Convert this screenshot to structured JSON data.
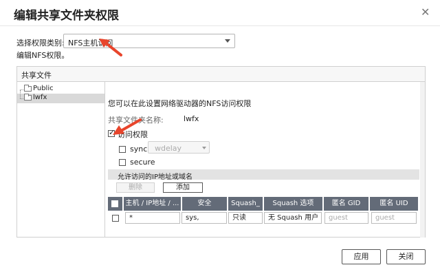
{
  "dialog": {
    "title": "编辑共享文件夹权限",
    "close_icon": "close-icon"
  },
  "perm": {
    "label": "选择权限类别:",
    "selected": "NFS主机访问",
    "description": "编辑NFS权限。"
  },
  "panel": {
    "header": "共享文件",
    "tree": [
      {
        "label": "Public",
        "selected": false
      },
      {
        "label": "lwfx",
        "selected": true
      }
    ],
    "description": "您可以在此设置网络驱动器的NFS访问权限",
    "share_name_label": "共享文件夹名称:",
    "share_name_value": "lwfx",
    "access": {
      "label": "访问权限",
      "checked": true
    },
    "sync": {
      "label": "sync",
      "checked": false,
      "mode": "wdelay"
    },
    "secure": {
      "label": "secure",
      "checked": false
    },
    "ip_section_title": "允许访问的IP地址或域名",
    "delete_label": "删除",
    "add_label": "添加",
    "columns": [
      "主机 / IP地址 / ...",
      "安全",
      "Squash_",
      "Squash 选项",
      "匿名 GID",
      "匿名 UID"
    ],
    "row": {
      "host": "*",
      "security": "sys,",
      "squash": "只读",
      "squash_option": "无 Squash 用户",
      "gid": "guest",
      "uid": "guest"
    }
  },
  "footer": {
    "apply": "应用",
    "close": "关闭"
  },
  "colors": {
    "header_dark": "#636b78",
    "arrow": "#e8452c"
  }
}
